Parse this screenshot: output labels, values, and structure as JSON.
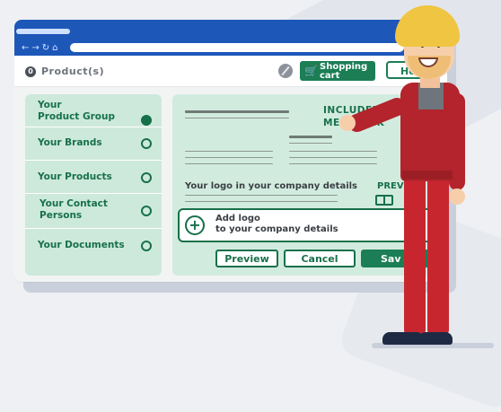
{
  "nav": {
    "icons": [
      "back-arrow-icon",
      "forward-arrow-icon",
      "refresh-icon",
      "home-icon"
    ]
  },
  "toolbar": {
    "product_label": "Product(s)",
    "cart_label_line1": "Shopping",
    "cart_label_line2": "cart",
    "help_label": "He"
  },
  "sidebar": {
    "items": [
      {
        "line1": "Your",
        "line2": "Product Group",
        "active": true
      },
      {
        "line1": "Your Brands",
        "line2": "",
        "active": false
      },
      {
        "line1": "Your Products",
        "line2": "",
        "active": false
      },
      {
        "line1": "Your Contact",
        "line2": "Persons",
        "active": false
      },
      {
        "line1": "Your Documents",
        "line2": "",
        "active": false
      }
    ]
  },
  "main": {
    "included_line1": "INCLUDED IN Y",
    "included_line2": "ME   A PACK",
    "logo_text": "Your logo in your company details",
    "preview_short": "PREV",
    "add_logo_line1": "Add logo",
    "add_logo_line2": "to your company details",
    "buttons": {
      "preview": "Preview",
      "cancel": "Cancel",
      "save": "Sav"
    }
  },
  "colors": {
    "primary_green": "#1b7e55",
    "light_green": "#cde9dc",
    "chrome_blue": "#1d57b8",
    "jacket_red": "#b3242c"
  }
}
